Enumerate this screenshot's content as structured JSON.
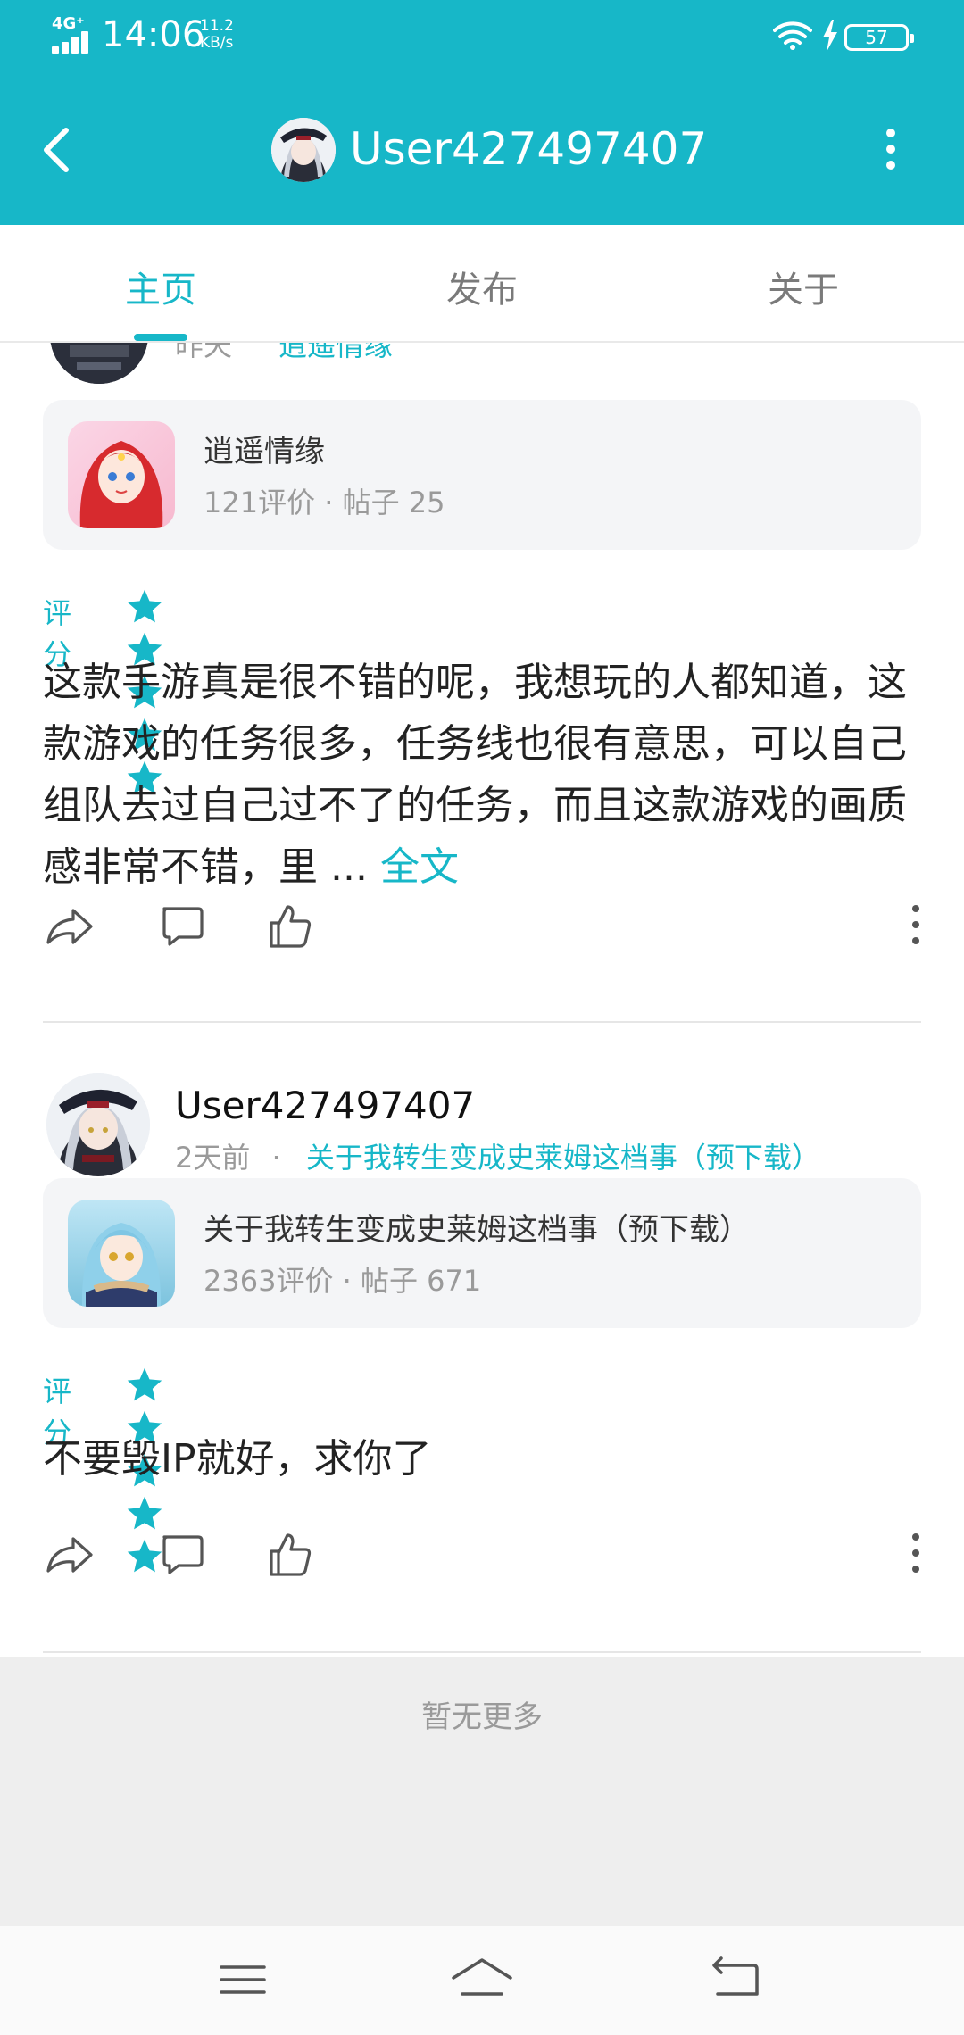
{
  "status_bar": {
    "network": "4G⁺",
    "time": "14:06",
    "speed_value": "11.2",
    "speed_unit": "KB/s",
    "battery": "57"
  },
  "header": {
    "title": "User427497407",
    "back_icon": "chevron-left-icon",
    "more_icon": "more-vertical-icon"
  },
  "tabs": [
    {
      "label": "主页",
      "active": true
    },
    {
      "label": "发布",
      "active": false
    },
    {
      "label": "关于",
      "active": false
    }
  ],
  "partial_post": {
    "time": "昨天",
    "game": "逍遥情缘"
  },
  "posts": [
    {
      "game_card": {
        "name": "逍遥情缘",
        "stats": "121评价 · 帖子 25"
      },
      "rating_label": "评分",
      "stars": 5,
      "text": "这款手游真是很不错的呢，我想玩的人都知道，这款游戏的任务很多，任务线也很有意思，可以自己组队去过自己过不了的任务，而且这款游戏的画质感非常不错，里 ...",
      "fulltext_label": "全文"
    },
    {
      "user": "User427497407",
      "time": "2天前",
      "dot": "·",
      "game": "关于我转生变成史莱姆这档事（预下载）",
      "game_card": {
        "name": "关于我转生变成史莱姆这档事（预下载）",
        "stats": "2363评价 · 帖子 671"
      },
      "rating_label": "评分",
      "stars": 5,
      "text": "不要毁IP就好，求你了"
    }
  ],
  "footer": {
    "no_more": "暂无更多"
  },
  "colors": {
    "accent": "#17b7c8",
    "footer_bg": "#eeeeee"
  }
}
